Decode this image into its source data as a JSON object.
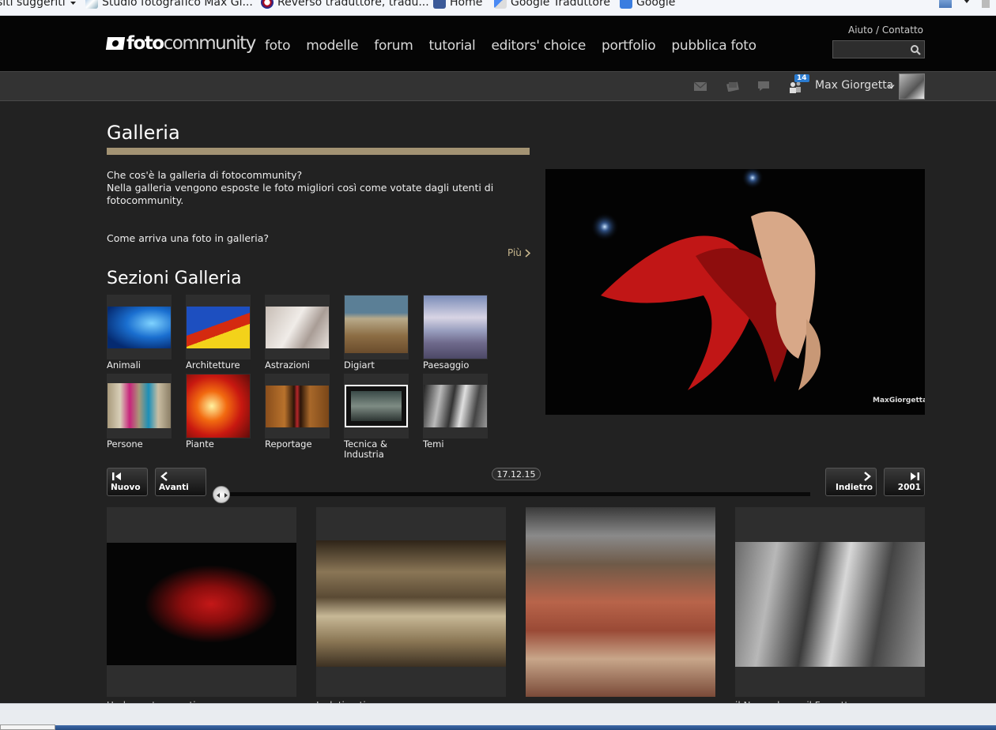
{
  "browser": {
    "bookmarks": [
      {
        "label": "siti suggeriti",
        "caret": true
      },
      {
        "label": "Studio fotografico Max Gi..."
      },
      {
        "label": "Reverso  traduttore, tradu..."
      },
      {
        "label": "Home"
      },
      {
        "label": "Google Traduttore"
      },
      {
        "label": "Google"
      }
    ]
  },
  "header": {
    "logo_bold": "foto",
    "logo_light": "community",
    "nav": [
      "foto",
      "modelle",
      "forum",
      "tutorial",
      "editors' choice",
      "portfolio",
      "pubblica foto"
    ],
    "help": "Aiuto",
    "separator": " / ",
    "contact": "Contatto",
    "search_placeholder": ""
  },
  "userbar": {
    "friends_count": "14",
    "user_name": "Max Giorgetta"
  },
  "gallery": {
    "title": "Galleria",
    "intro_q1": "Che cos'è la galleria di fotocommunity?",
    "intro_text": "Nella galleria vengono esposte le foto migliori così come votate dagli utenti di fotocommunity.",
    "intro_q2": "Come arriva una foto in galleria?",
    "more": "Più",
    "sections_title": "Sezioni Galleria",
    "sections": [
      {
        "label": "Animali"
      },
      {
        "label": "Architetture"
      },
      {
        "label": "Astrazioni"
      },
      {
        "label": "Digiart"
      },
      {
        "label": "Paesaggio"
      },
      {
        "label": "Persone"
      },
      {
        "label": "Piante"
      },
      {
        "label": "Reportage"
      },
      {
        "label": "Tecnica & Industria"
      },
      {
        "label": "Temi"
      }
    ],
    "featured_watermark": "MaxGiorgetta.it"
  },
  "timeline": {
    "newest": "Nuovo",
    "forward": "Avanti",
    "date": "17.12.15",
    "back": "Indietro",
    "oldest": "2001"
  },
  "strip": {
    "photos": [
      {
        "caption": "Under water emotion"
      },
      {
        "caption": "Isolation time"
      },
      {
        "caption": "...."
      },
      {
        "caption": "il Nonno legge il Fumetto"
      }
    ]
  }
}
